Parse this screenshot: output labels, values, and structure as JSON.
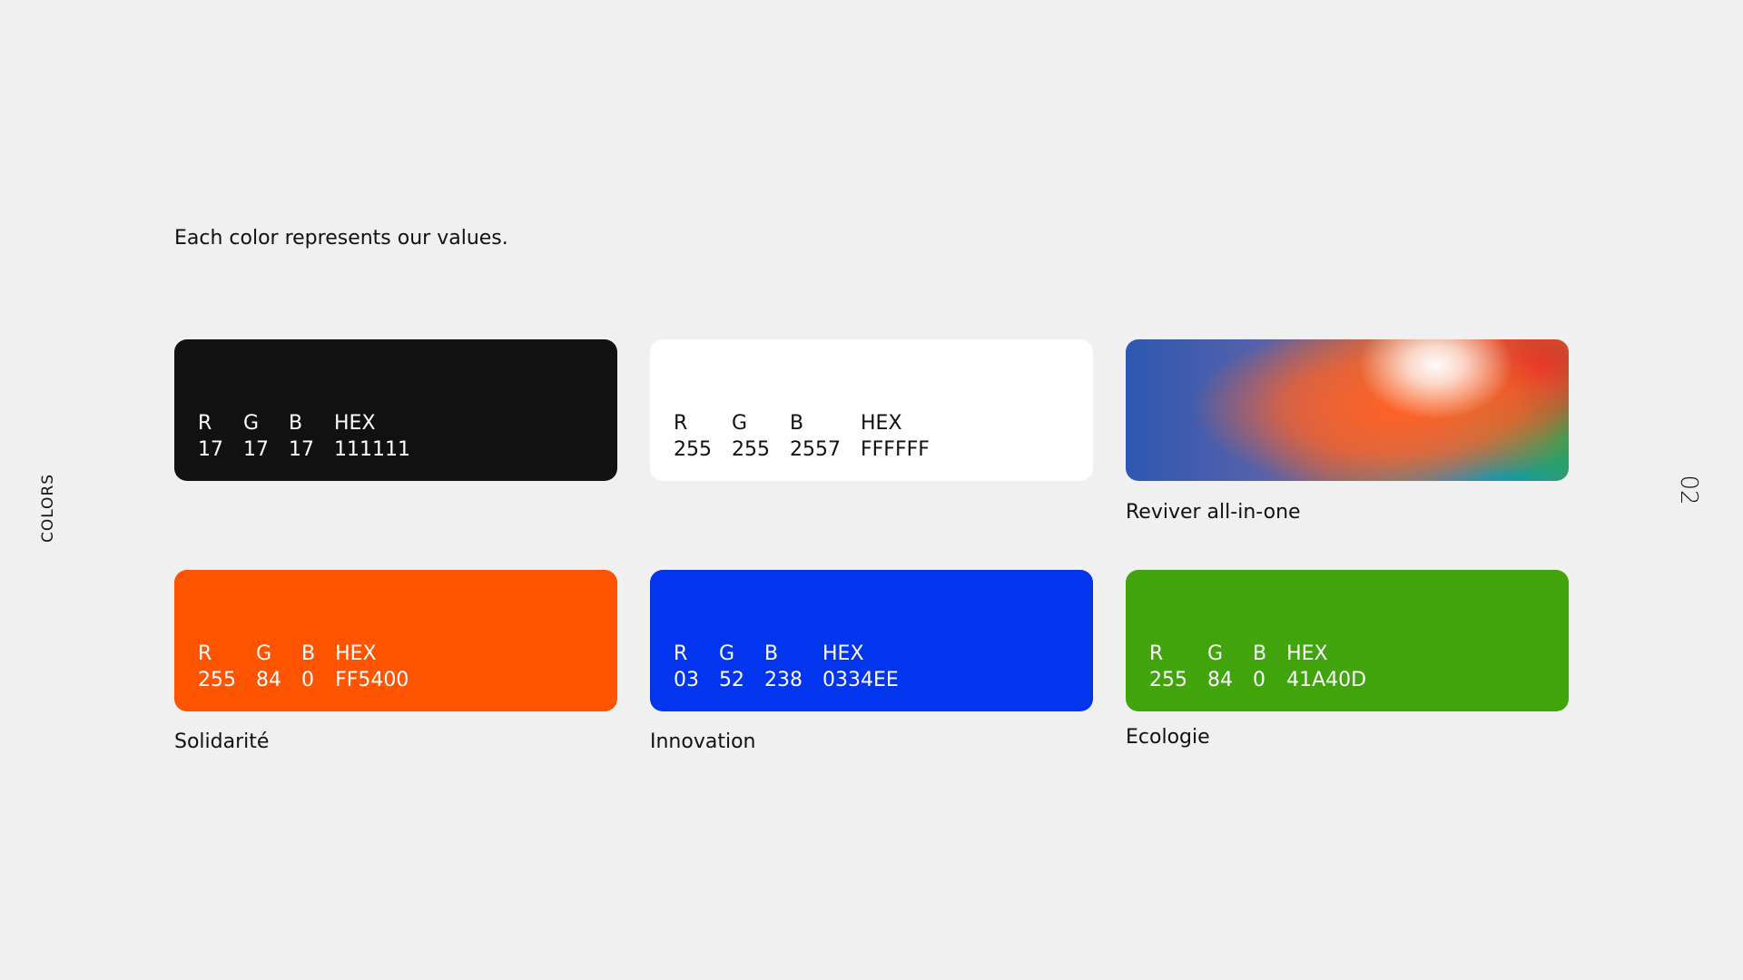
{
  "page": {
    "side_label": "COLORS",
    "page_number": "02",
    "intro_text": "Each color represents our values."
  },
  "swatches": [
    {
      "name": "black",
      "fill_color": "#111111",
      "text_color": "#ffffff",
      "labels": [
        "R",
        "G",
        "B",
        "HEX"
      ],
      "values": [
        "17",
        "17",
        "17",
        "111111"
      ]
    },
    {
      "name": "white",
      "fill_color": "#ffffff",
      "text_color": "#111111",
      "labels": [
        "R",
        "G",
        "B",
        "HEX"
      ],
      "values": [
        "255",
        "255",
        "2557",
        "FFFFFF"
      ]
    },
    {
      "name": "gradient",
      "caption": "Reviver all-in-one",
      "colors": [
        "#2d58b1",
        "#f46c23",
        "#ffffff",
        "#e82228",
        "#00b05c",
        "#0098d6"
      ]
    },
    {
      "name": "orange",
      "fill_color": "#ff5400",
      "text_color": "#ffffff",
      "labels": [
        "R",
        "G",
        "B",
        "HEX"
      ],
      "values": [
        "255",
        "84",
        "0",
        "FF5400"
      ],
      "caption": "Solidarité"
    },
    {
      "name": "blue",
      "fill_color": "#0334ee",
      "text_color": "#ffffff",
      "labels": [
        "R",
        "G",
        "B",
        "HEX"
      ],
      "values": [
        "03",
        "52",
        "238",
        "0334EE"
      ],
      "caption": "Innovation"
    },
    {
      "name": "green",
      "fill_color": "#41a40d",
      "text_color": "#ffffff",
      "labels": [
        "R",
        "G",
        "B",
        "HEX"
      ],
      "values": [
        "255",
        "84",
        "0",
        "41A40D"
      ],
      "caption": "Ecologie"
    }
  ]
}
